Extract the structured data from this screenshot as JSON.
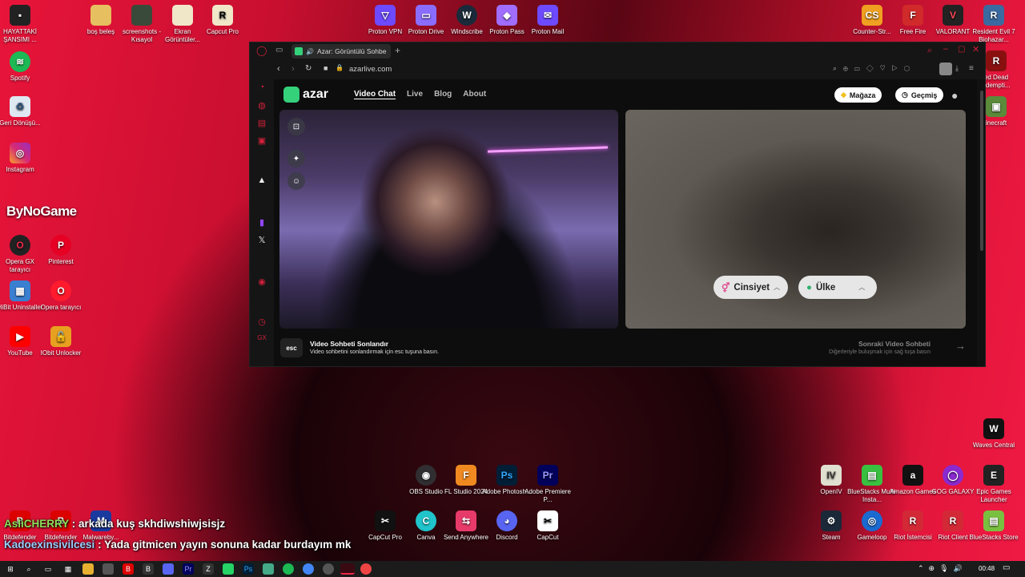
{
  "desktop": {
    "icons_left": [
      {
        "label": "HAYATTAKİ ŞANSIMI ..."
      },
      {
        "label": "boş beleş"
      },
      {
        "label": "screenshots - Kısayol"
      },
      {
        "label": "Ekran Görüntüler..."
      },
      {
        "label": "Capcut Pro"
      },
      {
        "label": "Spotify"
      },
      {
        "label": "Geri Dönüşü..."
      },
      {
        "label": "Instagram"
      },
      {
        "label": "Opera GX tarayıcı"
      },
      {
        "label": "Pinterest"
      },
      {
        "label": "HiBit Uninstaller"
      },
      {
        "label": "Opera tarayıcı"
      },
      {
        "label": "YouTube"
      },
      {
        "label": "IObit Unlocker"
      }
    ],
    "icons_top": [
      {
        "label": "Proton VPN"
      },
      {
        "label": "Proton Drive"
      },
      {
        "label": "Windscribe"
      },
      {
        "label": "Proton Pass"
      },
      {
        "label": "Proton Mail"
      }
    ],
    "icons_right": [
      {
        "label": "Counter-Str..."
      },
      {
        "label": "Free Fire"
      },
      {
        "label": "VALORANT"
      },
      {
        "label": "Resident Evil 7 Biohazar..."
      },
      {
        "label": "ed Dead edempti..."
      },
      {
        "label": "inecraft"
      },
      {
        "label": "Waves Central"
      }
    ],
    "icons_bottom": [
      {
        "label": "OBS Studio"
      },
      {
        "label": "FL Studio 2024"
      },
      {
        "label": "Adobe Photosh..."
      },
      {
        "label": "Adobe Premiere P..."
      },
      {
        "label": "CapCut Pro"
      },
      {
        "label": "Canva"
      },
      {
        "label": "Send Anywhere"
      },
      {
        "label": "Discord"
      },
      {
        "label": "CapCut"
      },
      {
        "label": "OpenIV"
      },
      {
        "label": "BlueStacks Multi-Insta..."
      },
      {
        "label": "Amazon Games"
      },
      {
        "label": "GOG GALAXY"
      },
      {
        "label": "Epic Games Launcher"
      },
      {
        "label": "Steam"
      },
      {
        "label": "Gameloop"
      },
      {
        "label": "Riot İstemcisi"
      },
      {
        "label": "Riot Client"
      },
      {
        "label": "BlueStacks Store"
      },
      {
        "label": "Bitdefender"
      },
      {
        "label": "Bitdefender"
      },
      {
        "label": "Malwareby..."
      }
    ],
    "brand_text": "ByNoGame"
  },
  "browser": {
    "tab_title": "Azar: Görüntülü Sohbe",
    "url": "azarlive.com"
  },
  "azar": {
    "logo_text": "azar",
    "nav": [
      "Video Chat",
      "Live",
      "Blog",
      "About"
    ],
    "store_label": "Mağaza",
    "history_label": "Geçmiş",
    "gender_filter": "Cinsiyet",
    "country_filter": "Ülke",
    "esc_key": "esc",
    "end_title": "Video Sohbeti Sonlandır",
    "end_desc": "Video sohbetini sonlandırmak için esc tuşuna basın.",
    "next_title": "Sonraki Video Sohbeti",
    "next_desc": "Diğerleriyle buluşmak için sağ tuşa basın"
  },
  "chat": [
    {
      "user": "AsliCHERRY",
      "sep": " : ",
      "text": "arkada kuş skhdiwshiwjsisjz"
    },
    {
      "user": "Kadoexinsivilcesi",
      "sep": " : ",
      "text": "Yada gitmicen yayın sonuna kadar burdayım mk"
    }
  ],
  "taskbar": {
    "time": "00:48"
  },
  "colors": {
    "accent_green": "#35d07a",
    "opera_red": "#d0203a"
  }
}
